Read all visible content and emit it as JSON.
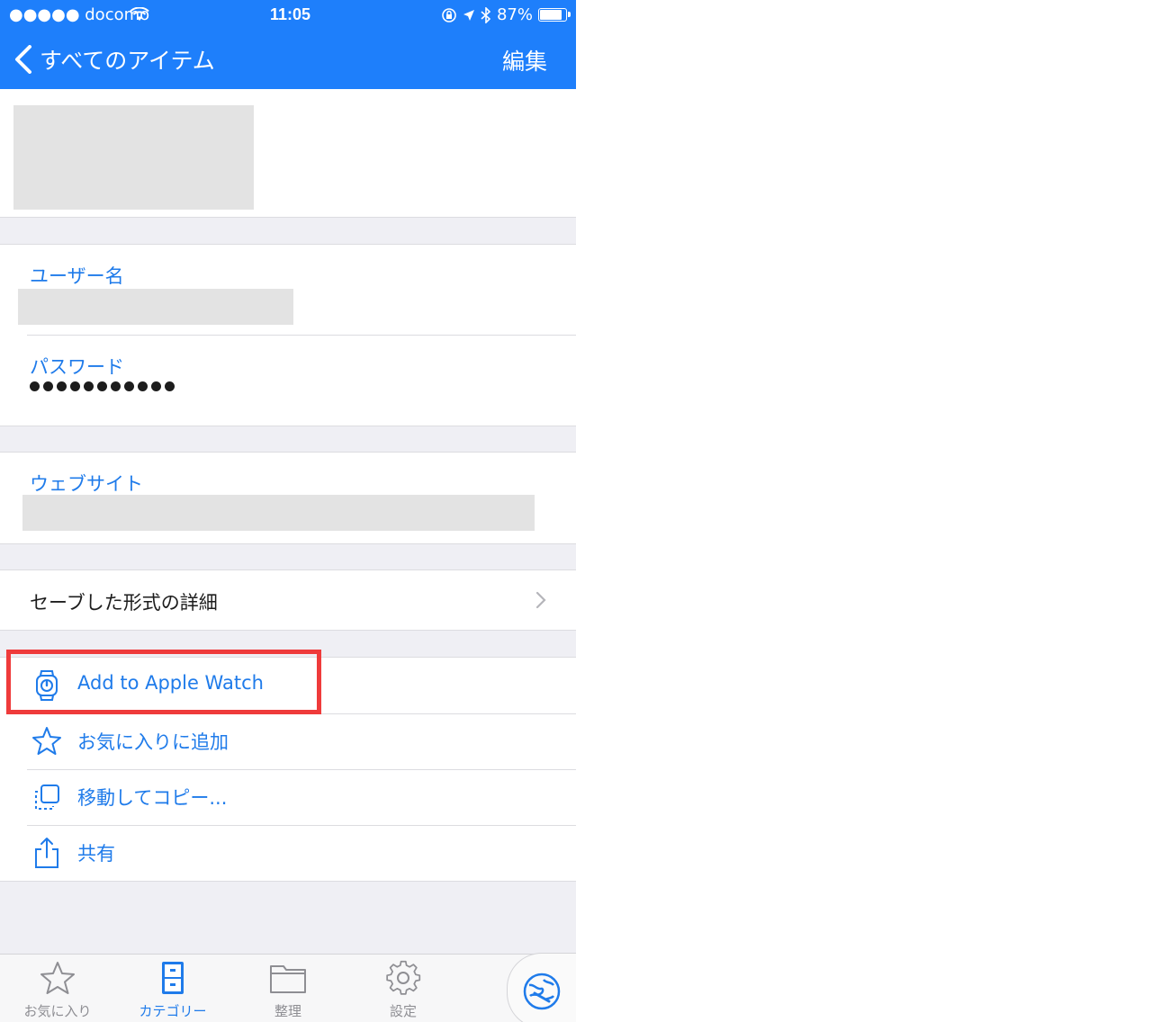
{
  "status_bar": {
    "carrier": "●●●●● docomo",
    "time": "11:05",
    "battery": "87%",
    "battery_level": 0.87
  },
  "nav": {
    "back_label": "すべてのアイテム",
    "edit_label": "編集"
  },
  "fields": {
    "username_label": "ユーザー名",
    "password_label": "パスワード",
    "password_mask": "●●●●●●●●●●●",
    "website_label": "ウェブサイト"
  },
  "saved_form": {
    "label": "セーブした形式の詳細"
  },
  "actions": [
    {
      "label": "Add to Apple Watch",
      "icon": "apple-watch-icon"
    },
    {
      "label": "お気に入りに追加",
      "icon": "star-icon"
    },
    {
      "label": "移動してコピー...",
      "icon": "move-copy-icon"
    },
    {
      "label": "共有",
      "icon": "share-icon"
    }
  ],
  "tabs": [
    {
      "label": "お気に入り",
      "icon": "star-icon"
    },
    {
      "label": "カテゴリー",
      "icon": "cabinet-icon",
      "active": true
    },
    {
      "label": "整理",
      "icon": "folder-icon"
    },
    {
      "label": "設定",
      "icon": "gear-icon"
    }
  ],
  "colors": {
    "accent": "#1e7ffb",
    "link": "#1f7bea",
    "highlight": "#ef3b3b",
    "background": "#efeff4"
  }
}
